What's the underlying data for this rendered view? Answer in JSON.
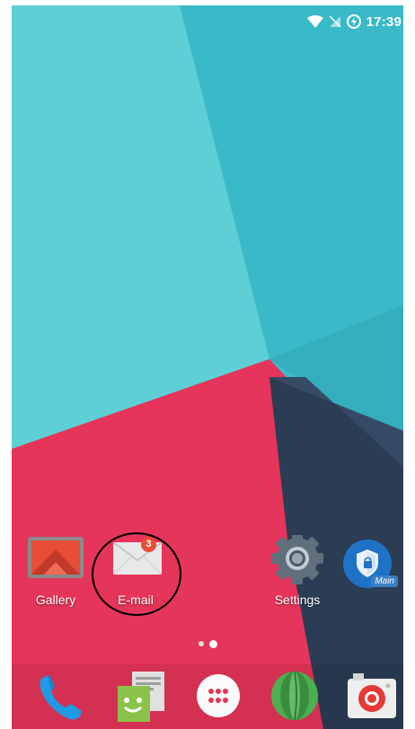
{
  "status_bar": {
    "time": "17:39",
    "icons": [
      "wifi-icon",
      "no-sim-icon",
      "battery-charging-icon"
    ]
  },
  "home": {
    "apps": [
      {
        "label": "Gallery",
        "icon": "gallery-icon"
      },
      {
        "label": "E-mail",
        "icon": "email-icon",
        "badge": "3"
      },
      {
        "label": "Settings",
        "icon": "settings-gear-icon"
      },
      {
        "label": "",
        "icon": "security-shield-icon",
        "sublabel": "Main"
      }
    ]
  },
  "page_indicator": {
    "pages": 2,
    "current": 2
  },
  "dock": {
    "items": [
      "phone-icon",
      "messaging-icon",
      "app-drawer-icon",
      "browser-icon",
      "camera-icon"
    ]
  },
  "colors": {
    "teal_light": "#5ccfd6",
    "teal_dark": "#3bb9c8",
    "pink": "#e6355a",
    "navy": "#2a3a52",
    "badge": "#e84d36"
  }
}
